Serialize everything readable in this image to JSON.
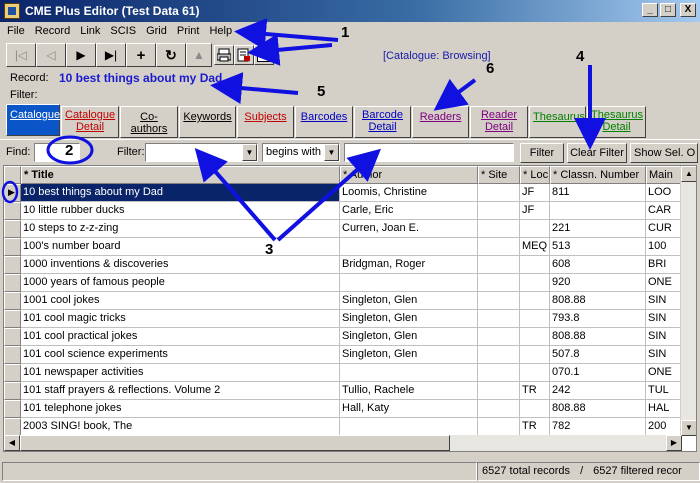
{
  "window": {
    "title": "CME Plus Editor  (Test Data 61)",
    "minimize": "_",
    "maximize": "□",
    "close": "X"
  },
  "menu": [
    "File",
    "Record",
    "Link",
    "SCIS",
    "Grid",
    "Print",
    "Help"
  ],
  "toolbar": {
    "first": "|◁",
    "prev": "◁",
    "next": "▶",
    "last": "▶|",
    "add": "+",
    "refresh": "↻",
    "catalogue_status": "[Catalogue: Browsing]"
  },
  "record": {
    "label": "Record:",
    "value": "10 best things about my Dad",
    "filter_label": "Filter:"
  },
  "annotations": [
    "1",
    "2",
    "3",
    "4",
    "5",
    "6"
  ],
  "tabs": [
    {
      "label": "Catalogue",
      "style": "active"
    },
    {
      "label": "Catalogue\nDetail",
      "style": "red"
    },
    {
      "label": "Co-authors",
      "style": "black"
    },
    {
      "label": "Keywords",
      "style": "black"
    },
    {
      "label": "Subjects",
      "style": "red"
    },
    {
      "label": "Barcodes",
      "style": "blue"
    },
    {
      "label": "Barcode\nDetail",
      "style": "blue"
    },
    {
      "label": "Readers",
      "style": "purple"
    },
    {
      "label": "Reader\nDetail",
      "style": "purple"
    },
    {
      "label": "Thesaurus",
      "style": "green"
    },
    {
      "label": "Thesaurus\nDetail",
      "style": "green"
    }
  ],
  "findbar": {
    "find_label": "Find:",
    "filter_label": "Filter:",
    "mode": "begins with",
    "filter_button": "Filter",
    "clear_filter_button": "Clear Filter",
    "show_sel_button": "Show Sel. O"
  },
  "grid": {
    "columns": [
      "* Title",
      "* Author",
      "* Site",
      "* Loc.",
      "* Classn. Number",
      "Main"
    ],
    "rows": [
      [
        "10 best things about my Dad",
        "Loomis, Christine",
        "",
        "JF",
        "811",
        "LOO"
      ],
      [
        "10 little rubber ducks",
        "Carle, Eric",
        "",
        "JF",
        "",
        "CAR"
      ],
      [
        "10 steps to z-z-zing",
        "Curren, Joan E.",
        "",
        "",
        "221",
        "CUR"
      ],
      [
        "100's number board",
        "",
        "",
        "MEQ",
        "513",
        "100"
      ],
      [
        "1000 inventions & discoveries",
        "Bridgman, Roger",
        "",
        "",
        "608",
        "BRI"
      ],
      [
        "1000 years of famous people",
        "",
        "",
        "",
        "920",
        "ONE"
      ],
      [
        "1001 cool jokes",
        "Singleton, Glen",
        "",
        "",
        "808.88",
        "SIN"
      ],
      [
        "101 cool magic tricks",
        "Singleton, Glen",
        "",
        "",
        "793.8",
        "SIN"
      ],
      [
        "101 cool practical jokes",
        "Singleton, Glen",
        "",
        "",
        "808.88",
        "SIN"
      ],
      [
        "101 cool science experiments",
        "Singleton, Glen",
        "",
        "",
        "507.8",
        "SIN"
      ],
      [
        "101 newspaper activities",
        "",
        "",
        "",
        "070.1",
        "ONE"
      ],
      [
        "101 staff prayers & reflections. Volume 2",
        "Tullio, Rachele",
        "",
        "TR",
        "242",
        "TUL"
      ],
      [
        "101 telephone jokes",
        "Hall, Katy",
        "",
        "",
        "808.88",
        "HAL"
      ],
      [
        "2003 SING! book, The",
        "",
        "",
        "TR",
        "782",
        "200"
      ]
    ]
  },
  "status": {
    "total": "6527 total records",
    "sep": "/",
    "filtered": "6527 filtered recor"
  }
}
